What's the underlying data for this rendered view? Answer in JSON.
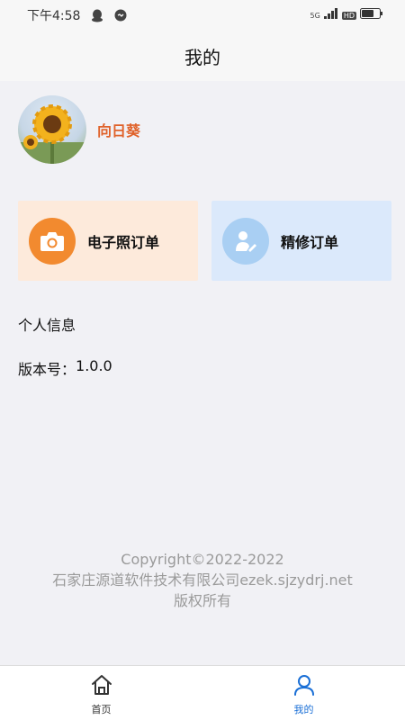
{
  "status_bar": {
    "time": "下午4:58",
    "network_small": "5G",
    "hd_label": "HD"
  },
  "header": {
    "title": "我的"
  },
  "profile": {
    "name": "向日葵"
  },
  "orders": [
    {
      "label": "电子照订单",
      "icon": "camera-icon",
      "color": "#f28a2f"
    },
    {
      "label": "精修订单",
      "icon": "person-retouch-icon",
      "color": "#a9cff3"
    }
  ],
  "info": {
    "personal": "个人信息",
    "version_label": "版本号：",
    "version_value": "1.0.0"
  },
  "copyright": {
    "line1": "Copyright©2022-2022",
    "line2": "石家庄源道软件技术有限公司ezek.sjzydrj.net",
    "line3": "版权所有"
  },
  "tabbar": {
    "tabs": [
      {
        "label": "首页",
        "icon": "home-icon",
        "active": false
      },
      {
        "label": "我的",
        "icon": "user-icon",
        "active": true
      }
    ]
  },
  "colors": {
    "accent": "#1a6fd6",
    "name": "#e0622a",
    "photo_card_bg": "#fdeadb",
    "retouch_card_bg": "#dbe9fb"
  }
}
